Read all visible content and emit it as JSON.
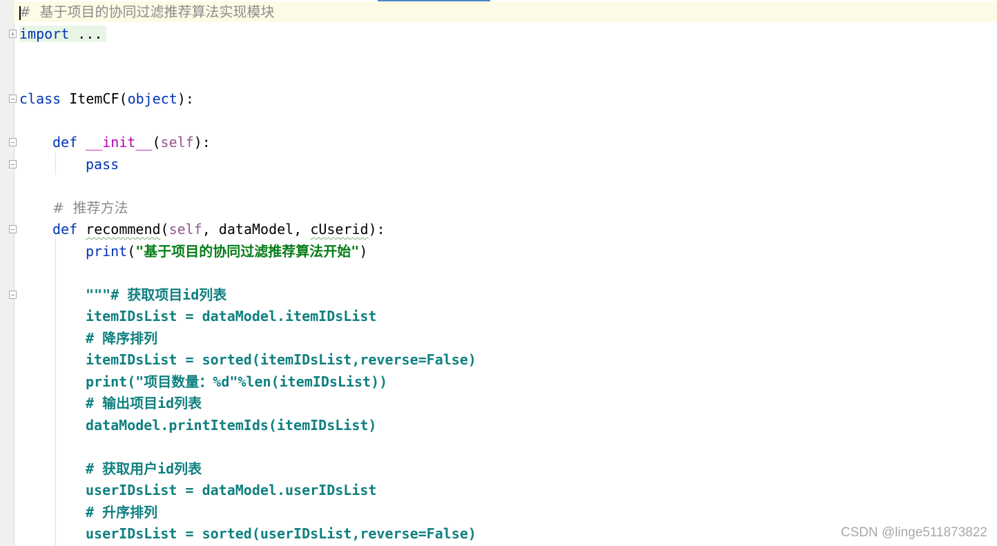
{
  "editor": {
    "lines": {
      "l1_comment": "#  基于项目的协同过滤推荐算法实现模块",
      "l2_import_kw": "import",
      "l2_import_rest": " ...",
      "l5_class_kw": "class",
      "l5_class_name": " ItemCF",
      "l5_open": "(",
      "l5_base": "object",
      "l5_close": "):",
      "l7_def": "def",
      "l7_name": "__init__",
      "l7_open": "(",
      "l7_self": "self",
      "l7_close": "):",
      "l8_pass": "pass",
      "l10_comment": "#  推荐方法",
      "l11_def": "def",
      "l11_name": "recommend",
      "l11_open": "(",
      "l11_self": "self",
      "l11_args_a": ", dataModel, ",
      "l11_args_b": "cUserid",
      "l11_close": "):",
      "l12_print": "print",
      "l12_open": "(",
      "l12_str": "\"基于项目的协同过滤推荐算法开始\"",
      "l12_close": ")",
      "l14": "\"\"\"# 获取项目id列表",
      "l15": "itemIDsList = dataModel.itemIDsList",
      "l16": "# 降序排列",
      "l17": "itemIDsList = sorted(itemIDsList,reverse=False)",
      "l18": "print(\"项目数量：%d\"%len(itemIDsList))",
      "l19": "# 输出项目id列表",
      "l20": "dataModel.printItemIds(itemIDsList)",
      "l22": "# 获取用户id列表",
      "l23": "userIDsList = dataModel.userIDsList",
      "l24": "# 升序排列",
      "l25": "userIDsList = sorted(userIDsList,reverse=False)"
    }
  },
  "watermark": "CSDN @linge511873822"
}
